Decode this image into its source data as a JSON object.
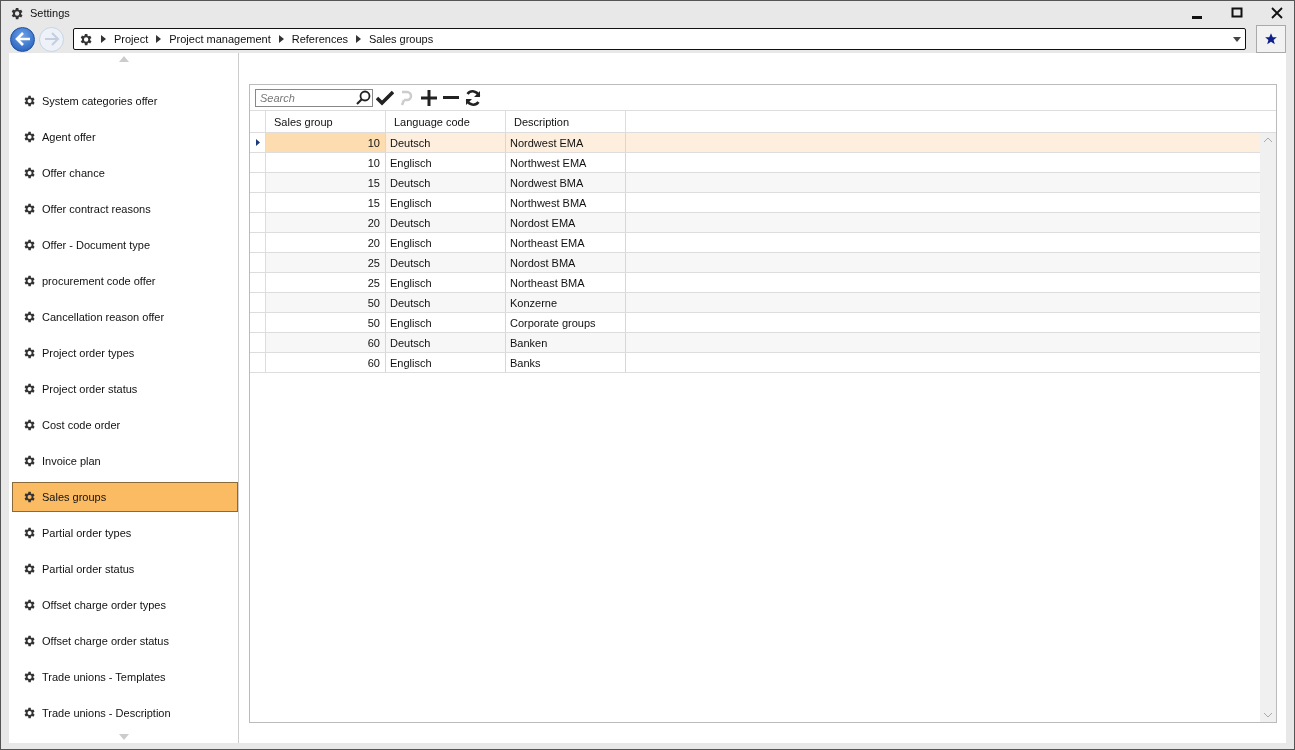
{
  "window": {
    "title": "Settings"
  },
  "breadcrumb": [
    "Project",
    "Project management",
    "References",
    "Sales groups"
  ],
  "sidebar": {
    "items": [
      {
        "label": "System categories offer",
        "selected": false
      },
      {
        "label": "Agent offer",
        "selected": false
      },
      {
        "label": "Offer chance",
        "selected": false
      },
      {
        "label": "Offer contract reasons",
        "selected": false
      },
      {
        "label": "Offer - Document type",
        "selected": false
      },
      {
        "label": "procurement code offer",
        "selected": false
      },
      {
        "label": "Cancellation reason offer",
        "selected": false
      },
      {
        "label": "Project order types",
        "selected": false
      },
      {
        "label": "Project order status",
        "selected": false
      },
      {
        "label": "Cost code order",
        "selected": false
      },
      {
        "label": "Invoice plan",
        "selected": false
      },
      {
        "label": "Sales groups",
        "selected": true
      },
      {
        "label": "Partial order types",
        "selected": false
      },
      {
        "label": "Partial order status",
        "selected": false
      },
      {
        "label": "Offset charge order types",
        "selected": false
      },
      {
        "label": "Offset charge order status",
        "selected": false
      },
      {
        "label": "Trade unions - Templates",
        "selected": false
      },
      {
        "label": "Trade unions - Description",
        "selected": false
      }
    ]
  },
  "search": {
    "placeholder": "Search"
  },
  "table": {
    "columns": [
      "Sales group",
      "Language code",
      "Description"
    ],
    "rows": [
      {
        "cells": [
          "10",
          "Deutsch",
          "Nordwest EMA"
        ],
        "selected": true
      },
      {
        "cells": [
          "10",
          "Englisch",
          "Northwest EMA"
        ],
        "selected": false
      },
      {
        "cells": [
          "15",
          "Deutsch",
          "Nordwest BMA"
        ],
        "selected": false
      },
      {
        "cells": [
          "15",
          "Englisch",
          "Northwest BMA"
        ],
        "selected": false
      },
      {
        "cells": [
          "20",
          "Deutsch",
          "Nordost EMA"
        ],
        "selected": false
      },
      {
        "cells": [
          "20",
          "Englisch",
          "Northeast EMA"
        ],
        "selected": false
      },
      {
        "cells": [
          "25",
          "Deutsch",
          "Nordost BMA"
        ],
        "selected": false
      },
      {
        "cells": [
          "25",
          "Englisch",
          "Northeast BMA"
        ],
        "selected": false
      },
      {
        "cells": [
          "50",
          "Deutsch",
          "Konzerne"
        ],
        "selected": false
      },
      {
        "cells": [
          "50",
          "Englisch",
          "Corporate groups"
        ],
        "selected": false
      },
      {
        "cells": [
          "60",
          "Deutsch",
          "Banken"
        ],
        "selected": false
      },
      {
        "cells": [
          "60",
          "Englisch",
          "Banks"
        ],
        "selected": false
      }
    ]
  }
}
